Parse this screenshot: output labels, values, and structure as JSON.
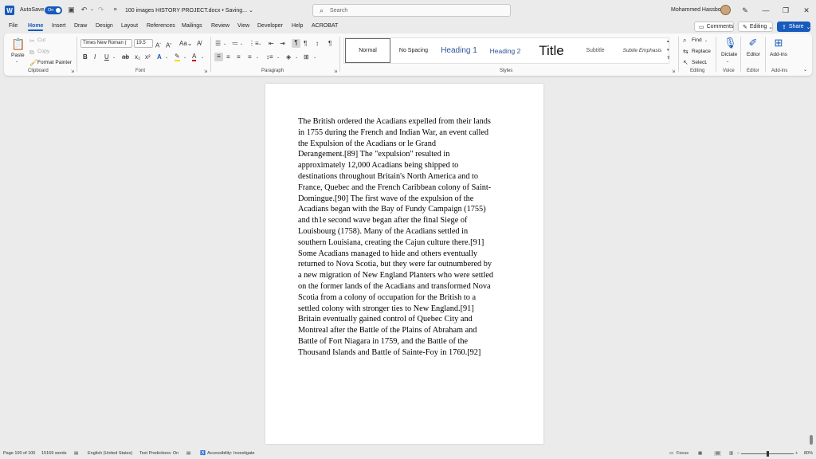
{
  "titlebar": {
    "app_letter": "W",
    "autosave_label": "AutoSave",
    "autosave_state": "On",
    "document_title": "100 images HISTORY PROJECT.docx • Saving...",
    "search_placeholder": "Search",
    "user_name": "Mohammed Hassbo"
  },
  "menu": {
    "tabs": [
      "File",
      "Home",
      "Insert",
      "Draw",
      "Design",
      "Layout",
      "References",
      "Mailings",
      "Review",
      "View",
      "Developer",
      "Help",
      "ACROBAT"
    ],
    "active": "Home",
    "comments_label": "Comments",
    "editing_label": "Editing",
    "share_label": "Share"
  },
  "ribbon": {
    "clipboard": {
      "paste": "Paste",
      "cut": "Cut",
      "copy": "Copy",
      "format_painter": "Format Painter",
      "label": "Clipboard"
    },
    "font": {
      "font_name": "Times New Roman (",
      "font_size": "19.5",
      "label": "Font"
    },
    "paragraph": {
      "label": "Paragraph"
    },
    "styles": {
      "items": [
        "Normal",
        "No Spacing",
        "Heading 1",
        "Heading 2",
        "Title",
        "Subtitle",
        "Subtle Emphasis"
      ],
      "label": "Styles"
    },
    "editing": {
      "find": "Find",
      "replace": "Replace",
      "select": "Select",
      "label": "Editing"
    },
    "voice": {
      "dictate": "Dictate",
      "label": "Voice"
    },
    "editor": {
      "editor": "Editor",
      "label": "Editor"
    },
    "addins": {
      "addins": "Add-ins",
      "label": "Add-ins"
    },
    "colors": {
      "accent": "#185abd",
      "highlight": "#ffd800",
      "font_color": "#c00000"
    }
  },
  "document": {
    "lines": [
      "The British ordered the Acadians expelled from their lands",
      "in 1755 during the French and Indian War, an event called",
      "the Expulsion of the Acadians or le Grand",
      "Derangement.[89] The \"expulsion\" resulted in",
      "approximately 12,000 Acadians being shipped to",
      "destinations throughout Britain's North America and to",
      "France, Quebec and the French Caribbean colony of Saint-",
      "Domingue.[90] The first wave of the expulsion of the",
      "Acadians began with the Bay of Fundy Campaign (1755)",
      "and th1e second wave began after the final Siege of",
      "Louisbourg (1758). Many of the Acadians settled in",
      "southern Louisiana, creating the Cajun culture there.[91]",
      "Some Acadians managed to hide and others eventually",
      "returned to Nova Scotia, but they were far outnumbered by",
      "a new migration of New England Planters who were settled",
      "on the former lands of the Acadians and transformed Nova",
      "Scotia from a colony of occupation for the British to a",
      "settled colony with stronger ties to New England.[91]",
      "Britain eventually gained control of Quebec City and",
      "Montreal after the Battle of the Plains of Abraham and",
      "Battle of Fort Niagara in 1759, and the Battle of the",
      "Thousand Islands and Battle of Sainte-Foy in 1760.[92]"
    ]
  },
  "status": {
    "page": "Page 100 of 100",
    "words": "15169 words",
    "language": "English (United States)",
    "predictions": "Text Predictions: On",
    "accessibility": "Accessibility: Investigate",
    "focus": "Focus",
    "zoom": "80%",
    "zoom_minus": "−",
    "zoom_plus": "+"
  }
}
